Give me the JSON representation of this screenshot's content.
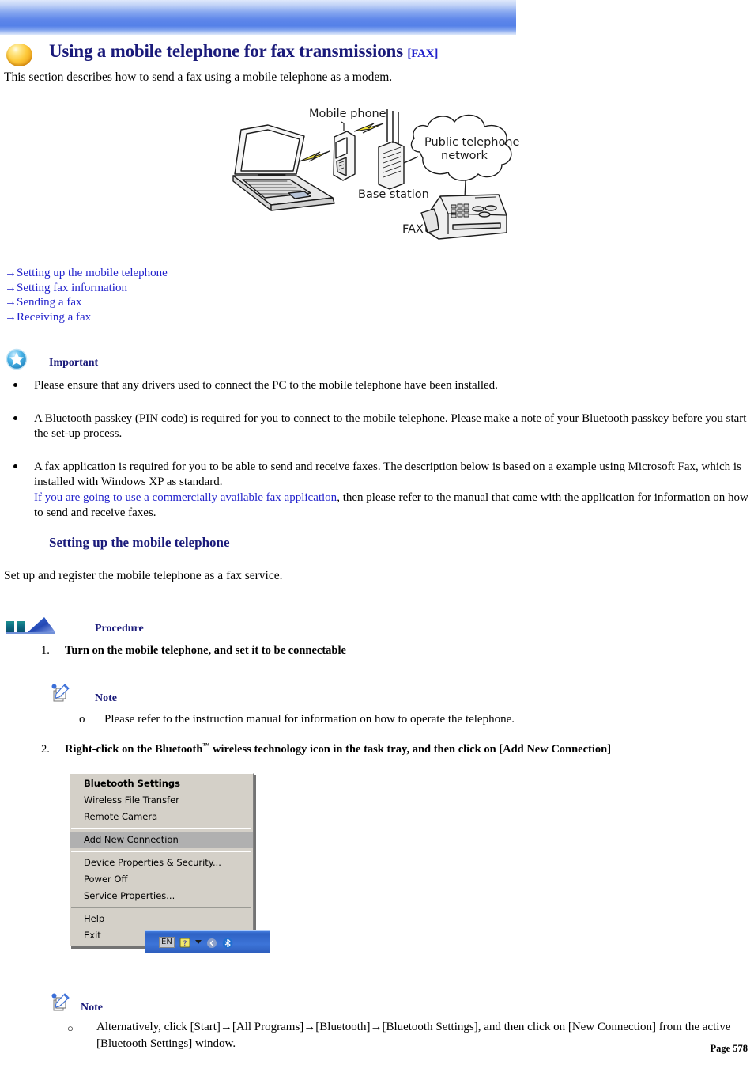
{
  "header": {
    "banner_color_top": "#dfe8fb",
    "banner_color_mid": "#5480e8",
    "title": "Using a mobile telephone for fax transmissions",
    "title_tag": "[FAX]",
    "title_color": "#1a1a7a",
    "lead": "This section describes how to send a fax using a mobile telephone as a modem.",
    "orb_icon": "gold-orb-icon"
  },
  "diagram": {
    "alt": "network-diagram",
    "labels": {
      "mobile_phone": "Mobile phone",
      "base_station": "Base station",
      "network": "Public telephone",
      "network2": "network",
      "fax": "FAX"
    }
  },
  "links": {
    "arrow": "→",
    "items": [
      {
        "label": "Setting up the mobile telephone"
      },
      {
        "label": "Setting fax information"
      },
      {
        "label": "Sending a fax"
      },
      {
        "label": "Receiving a fax"
      }
    ],
    "color": "#2222cc"
  },
  "important": {
    "icon": "blue-star-badge-icon",
    "label": "Important",
    "bullets": [
      {
        "text": "Please ensure that any drivers used to connect the PC to the mobile telephone have been installed."
      },
      {
        "text": "A Bluetooth passkey (PIN code) is required for you to connect to the mobile telephone. Please make a note of your Bluetooth passkey before you start the set-up process."
      },
      {
        "pre": "A fax application is required for you to be able to send and receive faxes. The description below is based on a example using Microsoft Fax, which is installed with Windows XP as standard.",
        "link": "If you are going to use a commercially available fax application",
        "post": ", then please refer to the manual that came with the application for information on how to send and receive faxes."
      }
    ]
  },
  "section": {
    "heading": "Setting up the mobile telephone",
    "intro": "Set up and register the mobile telephone as a fax service."
  },
  "procedure": {
    "icon": "blue-triangle-procedure-icon",
    "label": "Procedure",
    "steps": [
      {
        "num": "1.",
        "text": "Turn on the mobile telephone, and set it to be connectable"
      },
      {
        "num": "2.",
        "text_pre": "Right-click on the Bluetooth",
        "tm": "™",
        "text_post": " wireless technology icon in the task tray, and then click on [Add New Connection]"
      }
    ]
  },
  "note_top": {
    "icon": "note-pencil-icon",
    "label": "Note",
    "marker": "o",
    "text": "Please refer to the instruction manual for information on how to operate the telephone."
  },
  "note_bottom": {
    "icon": "note-pencil-icon",
    "label": "Note",
    "marker": "○",
    "text": "Alternatively, click [Start]→[All Programs]→[Bluetooth]→[Bluetooth Settings], and then click on [New Connection] from the active [Bluetooth Settings] window."
  },
  "bluetooth_menu": {
    "items": [
      {
        "label": "Bluetooth Settings",
        "bold": true,
        "selected": false
      },
      {
        "label": "Wireless File Transfer",
        "bold": false,
        "selected": false
      },
      {
        "label": "Remote Camera",
        "bold": false,
        "selected": false
      },
      {
        "separator": true
      },
      {
        "label": "Add New Connection",
        "bold": false,
        "selected": true
      },
      {
        "separator": true
      },
      {
        "label": "Device Properties & Security...",
        "bold": false,
        "selected": false
      },
      {
        "label": "Power Off",
        "bold": false,
        "selected": false
      },
      {
        "label": "Service Properties...",
        "bold": false,
        "selected": false
      },
      {
        "separator": true
      },
      {
        "label": "Help",
        "bold": false,
        "selected": false
      },
      {
        "label": "Exit",
        "bold": false,
        "selected": false
      }
    ],
    "tray": {
      "language": "EN",
      "icons": [
        "help-balloon-icon",
        "chevron-down-icon",
        "hide-icons-icon",
        "bluetooth-icon"
      ]
    }
  },
  "footer": {
    "page": "Page 578"
  }
}
